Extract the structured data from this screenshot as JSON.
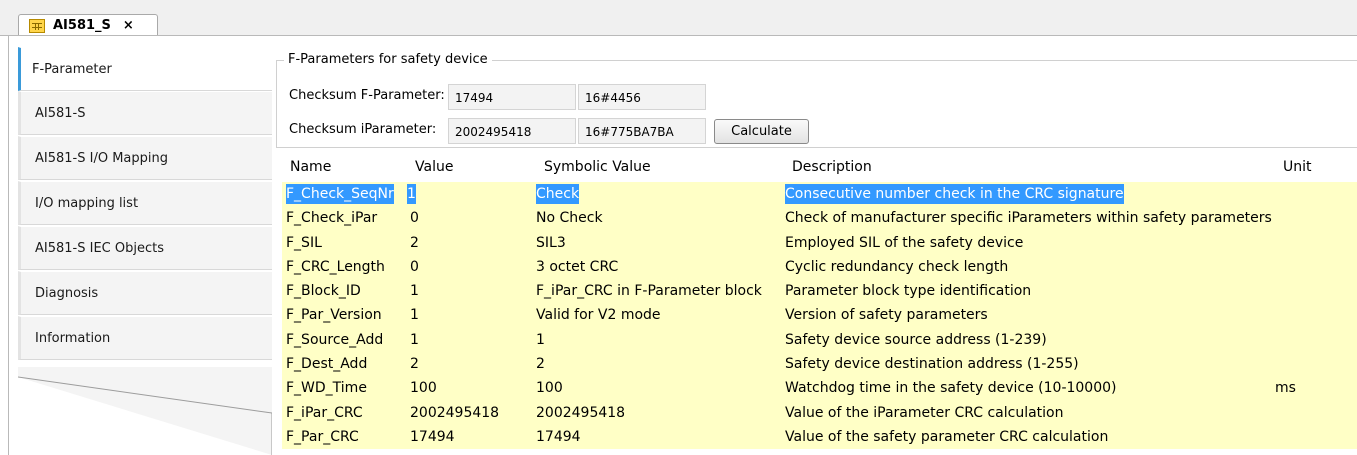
{
  "editor_tab": {
    "title": "AI581_S",
    "close": "×"
  },
  "sidebar": {
    "items": [
      {
        "label": "F-Parameter",
        "active": true
      },
      {
        "label": "AI581-S"
      },
      {
        "label": "AI581-S I/O Mapping"
      },
      {
        "label": "I/O mapping list"
      },
      {
        "label": "AI581-S IEC Objects"
      },
      {
        "label": "Diagnosis"
      },
      {
        "label": "Information"
      }
    ]
  },
  "group": {
    "title": "F-Parameters for safety device",
    "checksum_f": {
      "label": "Checksum F-Parameter:",
      "dec": "17494",
      "hex": "16#4456"
    },
    "checksum_i": {
      "label": "Checksum iParameter:",
      "dec": "2002495418",
      "hex": "16#775BA7BA"
    },
    "calculate_label": "Calculate"
  },
  "table": {
    "headers": [
      "Name",
      "Value",
      "Symbolic Value",
      "Description",
      "Unit"
    ],
    "rows": [
      {
        "name": "F_Check_SeqNr",
        "value": "1",
        "symbolic": "Check",
        "description": "Consecutive number check in the CRC signature",
        "unit": ""
      },
      {
        "name": "F_Check_iPar",
        "value": "0",
        "symbolic": "No Check",
        "description": "Check of manufacturer specific iParameters within safety parameters",
        "unit": ""
      },
      {
        "name": "F_SIL",
        "value": "2",
        "symbolic": "SIL3",
        "description": "Employed SIL of the safety device",
        "unit": ""
      },
      {
        "name": "F_CRC_Length",
        "value": "0",
        "symbolic": "3 octet CRC",
        "description": "Cyclic redundancy check length",
        "unit": ""
      },
      {
        "name": "F_Block_ID",
        "value": "1",
        "symbolic": "F_iPar_CRC in F-Parameter block",
        "description": "Parameter block type identification",
        "unit": ""
      },
      {
        "name": "F_Par_Version",
        "value": "1",
        "symbolic": "Valid for V2 mode",
        "description": "Version of safety parameters",
        "unit": ""
      },
      {
        "name": "F_Source_Add",
        "value": "1",
        "symbolic": "1",
        "description": "Safety device source address (1-239)",
        "unit": ""
      },
      {
        "name": "F_Dest_Add",
        "value": "2",
        "symbolic": "2",
        "description": "Safety device destination address (1-255)",
        "unit": ""
      },
      {
        "name": "F_WD_Time",
        "value": "100",
        "symbolic": "100",
        "description": "Watchdog time in the safety device (10-10000)",
        "unit": "ms"
      },
      {
        "name": "F_iPar_CRC",
        "value": "2002495418",
        "symbolic": "2002495418",
        "description": "Value of the iParameter CRC calculation",
        "unit": ""
      },
      {
        "name": "F_Par_CRC",
        "value": "17494",
        "symbolic": "17494",
        "description": "Value of the safety parameter CRC calculation",
        "unit": ""
      }
    ]
  },
  "colors": {
    "row_bg": "#ffffc6",
    "selection": "#3399ff",
    "active_tab_accent": "#3a9ad9"
  }
}
